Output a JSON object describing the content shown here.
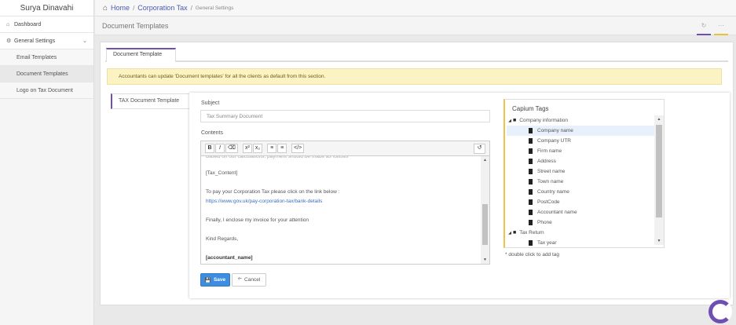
{
  "sidebar": {
    "user_name": "Surya Dinavahi",
    "items": [
      {
        "label": "Dashboard",
        "icon": "home-icon"
      },
      {
        "label": "General Settings",
        "icon": "gears-icon",
        "expanded": true
      }
    ],
    "sub_items": [
      {
        "label": "Email Templates",
        "active": false
      },
      {
        "label": "Document Templates",
        "active": true
      },
      {
        "label": "Logo on Tax Document",
        "active": false
      }
    ]
  },
  "breadcrumb": {
    "home": "Home",
    "section": "Corporation Tax",
    "current": "General Settings"
  },
  "page": {
    "title": "Document Templates",
    "icons": [
      "refresh-icon",
      "more-icon"
    ]
  },
  "tabs": {
    "main": "Document Template",
    "side": "TAX Document Template"
  },
  "alert": {
    "text": "Accountants can update 'Document templates' for all the clients as default from this section."
  },
  "form": {
    "subject_label": "Subject",
    "subject_value": "Tax Summary Document",
    "contents_label": "Contents",
    "toolbar": [
      "B",
      "I",
      "eraser",
      "x²",
      "x₂",
      "ul",
      "ol",
      "</>",
      "undo"
    ],
    "editor_lines": [
      {
        "text": "[Tax_Content]",
        "style": "normal"
      },
      {
        "text": "To pay your Corporation Tax please click on the link below :",
        "style": "normal"
      },
      {
        "text": "https://www.gov.uk/pay-corporation-tax/bank-details",
        "style": "link"
      },
      {
        "text": "Finally, I enclose my invoice for your attention",
        "style": "normal"
      },
      {
        "text": "Kind Regards,",
        "style": "normal"
      },
      {
        "text": "[accountant_name]",
        "style": "bold"
      }
    ],
    "save_label": "Save",
    "cancel_label": "Cancel"
  },
  "tags": {
    "title": "Capium Tags",
    "groups": [
      {
        "name": "Company information",
        "expanded": true,
        "items": [
          "Company name",
          "Company UTR",
          "Firm name",
          "Address",
          "Street name",
          "Town name",
          "Country name",
          "PostCode",
          "Accountant name",
          "Phone"
        ],
        "selected": "Company name"
      },
      {
        "name": "Tax Return",
        "expanded": true,
        "items": [
          "Tax year"
        ]
      }
    ],
    "hint": "* double click to add tag"
  },
  "colors": {
    "accent": "#6f4fb3",
    "link": "#4a5bb0",
    "alert_bg": "#fcf3c4",
    "save_button": "#3d8ee0",
    "tags_border": "#f0c24a"
  }
}
